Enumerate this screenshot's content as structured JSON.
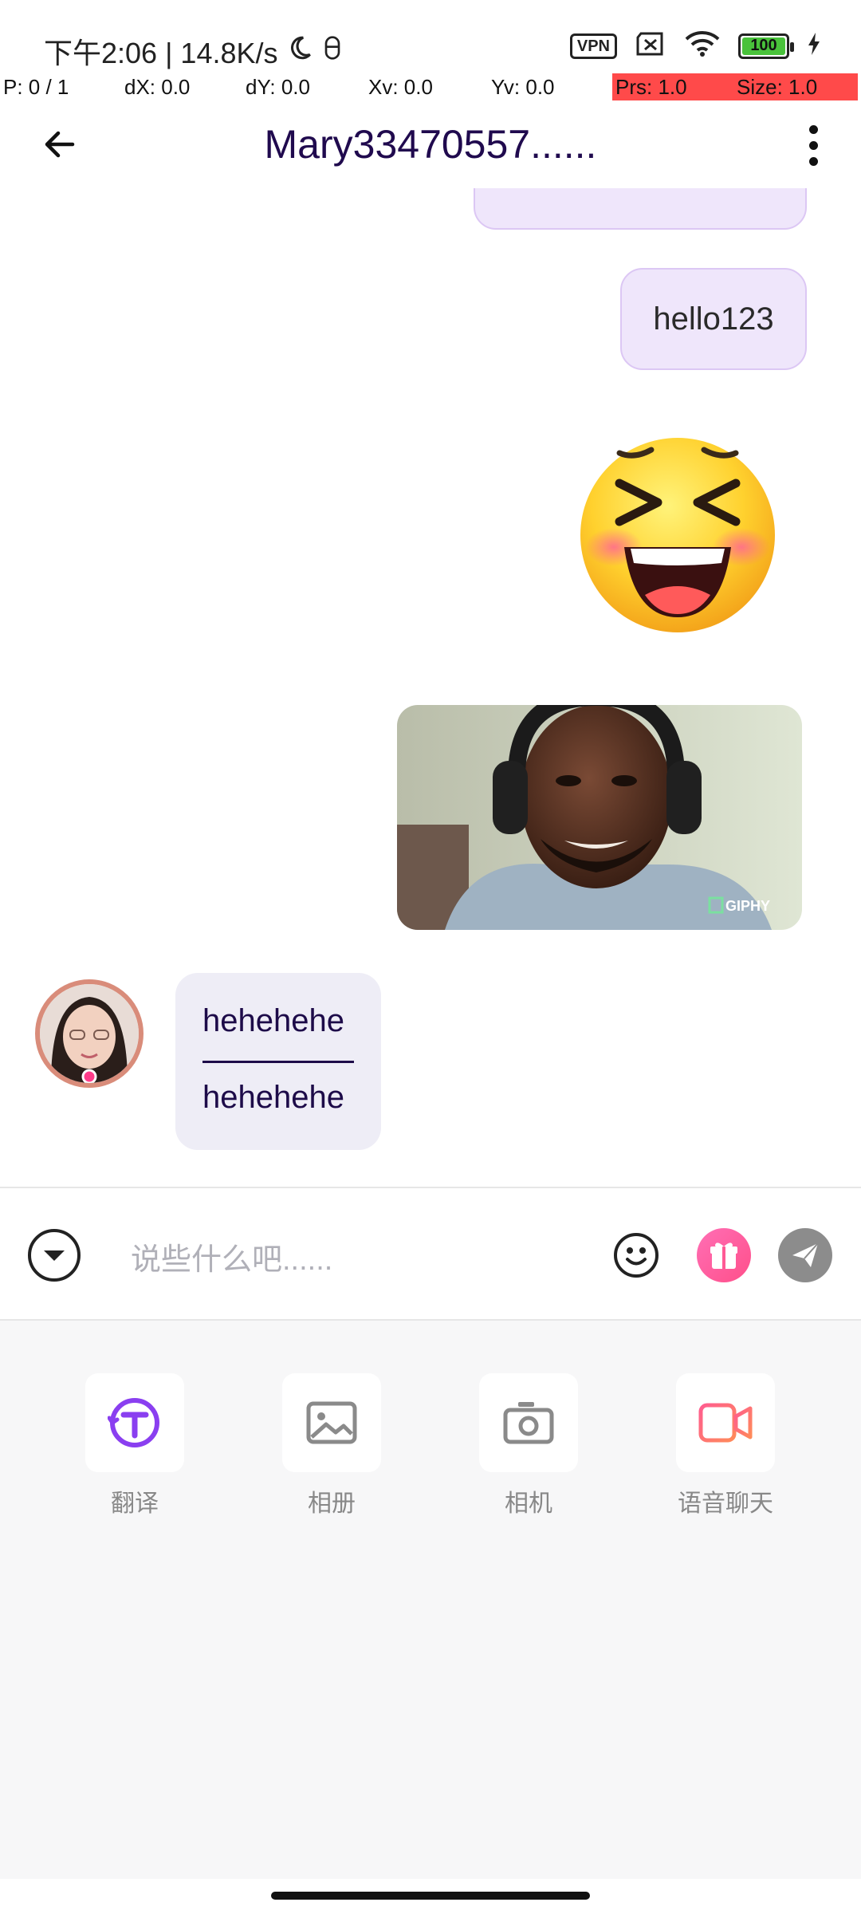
{
  "status_bar": {
    "time_and_speed": "下午2:06 | 14.8K/s",
    "vpn": "VPN",
    "battery": "100"
  },
  "debug": {
    "p": "P: 0 / 1",
    "dx": "dX: 0.0",
    "dy": "dY: 0.0",
    "xv": "Xv: 0.0",
    "yv": "Yv: 0.0",
    "prs": "Prs: 1.0",
    "size": "Size: 1.0"
  },
  "header": {
    "title": "Mary33470557......"
  },
  "messages": {
    "partial_bubble": "...",
    "outgoing_text": "hello123",
    "gif_watermark": "GIPHY",
    "incoming_original": "hehehehe",
    "incoming_translation": "hehehehe"
  },
  "input": {
    "placeholder": "说些什么吧......"
  },
  "tools": [
    {
      "label": "翻译",
      "icon": "translate-icon"
    },
    {
      "label": "相册",
      "icon": "gallery-icon"
    },
    {
      "label": "相机",
      "icon": "camera-icon"
    },
    {
      "label": "语音聊天",
      "icon": "video-call-icon"
    }
  ],
  "colors": {
    "accent": "#8a3ff0",
    "outgoing_bubble": "#efe6fb",
    "incoming_bubble": "#eeedf6",
    "title": "#200a4e"
  }
}
